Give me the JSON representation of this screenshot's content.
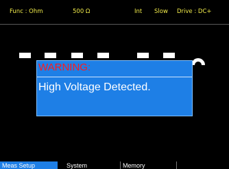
{
  "status_bar": {
    "function": "Func : Ohm",
    "range": "500 Ω",
    "trigger": "Int",
    "rate": "Slow",
    "drive": "Drive : DC+"
  },
  "reading": {
    "unit_glyph": "Ω"
  },
  "dialog": {
    "title": "WARNING:",
    "message": "High Voltage Detected."
  },
  "softkeys": [
    {
      "label": "Meas Setup",
      "active": true
    },
    {
      "label": "System",
      "active": false
    },
    {
      "label": "Memory",
      "active": false
    },
    {
      "label": "",
      "active": false
    },
    {
      "label": "",
      "active": false
    }
  ],
  "colors": {
    "background": "#000000",
    "status_text": "#f0ea4a",
    "dialog_bg": "#1e7fe6",
    "warning_text": "#ff1a1a",
    "active_softkey": "#1e7fe6"
  }
}
